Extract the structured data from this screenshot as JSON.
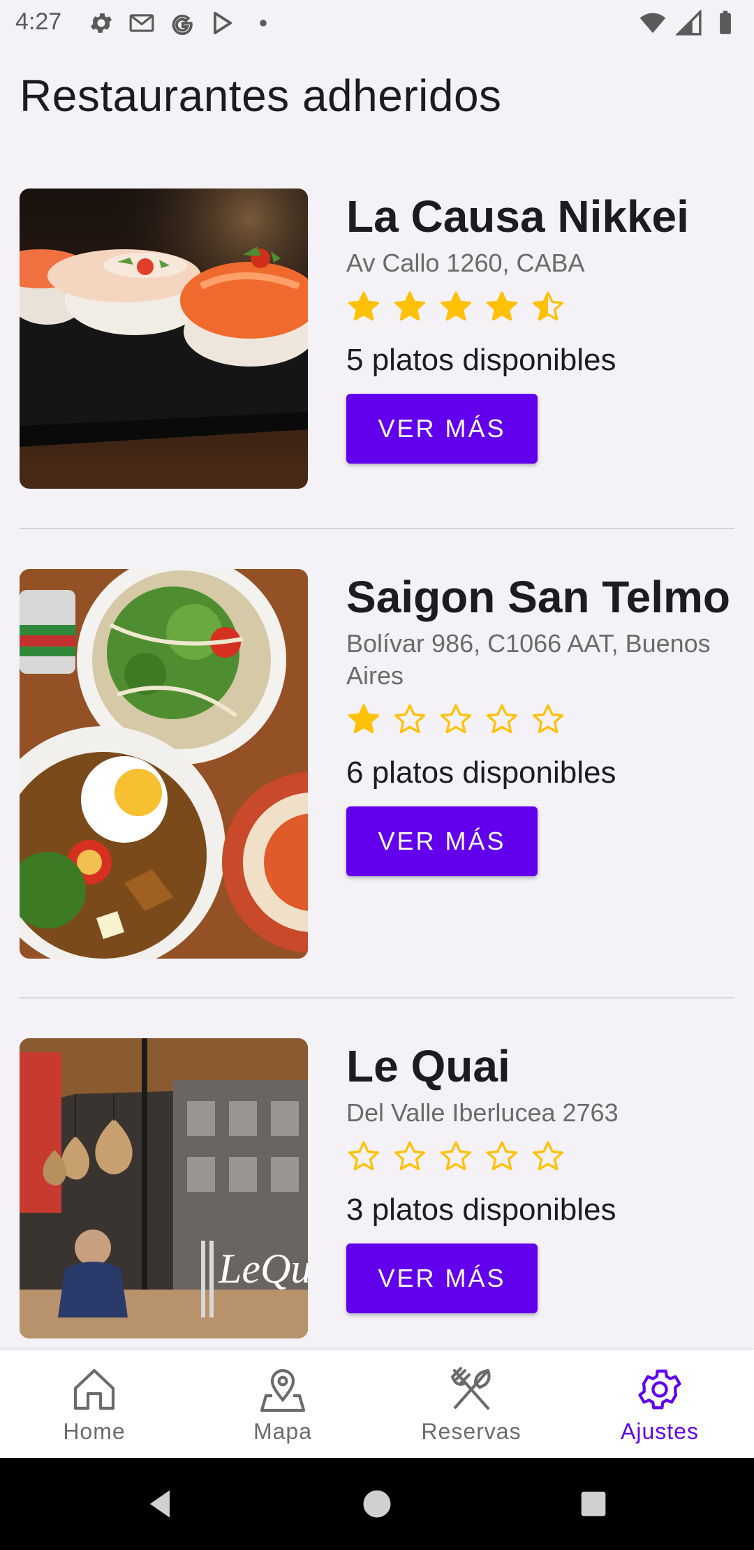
{
  "status_bar": {
    "time": "4:27"
  },
  "page_title": "Restaurantes adheridos",
  "restaurants": [
    {
      "name": "La Causa Nikkei",
      "address": "Av Callo 1260, CABA",
      "rating": 4.5,
      "platos": "5 platos disponibles",
      "button": "VER MÁS"
    },
    {
      "name": "Saigon San Telmo",
      "address": "Bolívar 986, C1066 AAT, Buenos Aires",
      "rating": 1,
      "platos": "6 platos disponibles",
      "button": "VER MÁS"
    },
    {
      "name": "Le Quai",
      "address": "Del Valle Iberlucea 2763",
      "rating": 0,
      "platos": "3 platos disponibles",
      "button": "VER MÁS"
    }
  ],
  "image_text": {
    "le_quai_sign": "LeQuai"
  },
  "bottom_nav": [
    {
      "label": "Home",
      "icon": "home-icon",
      "active": false
    },
    {
      "label": "Mapa",
      "icon": "map-pin-icon",
      "active": false
    },
    {
      "label": "Reservas",
      "icon": "fork-knife-icon",
      "active": false
    },
    {
      "label": "Ajustes",
      "icon": "gear-icon",
      "active": true
    }
  ],
  "colors": {
    "accent": "#6200ee",
    "star": "#ffc107",
    "background": "#f4f2f6"
  }
}
